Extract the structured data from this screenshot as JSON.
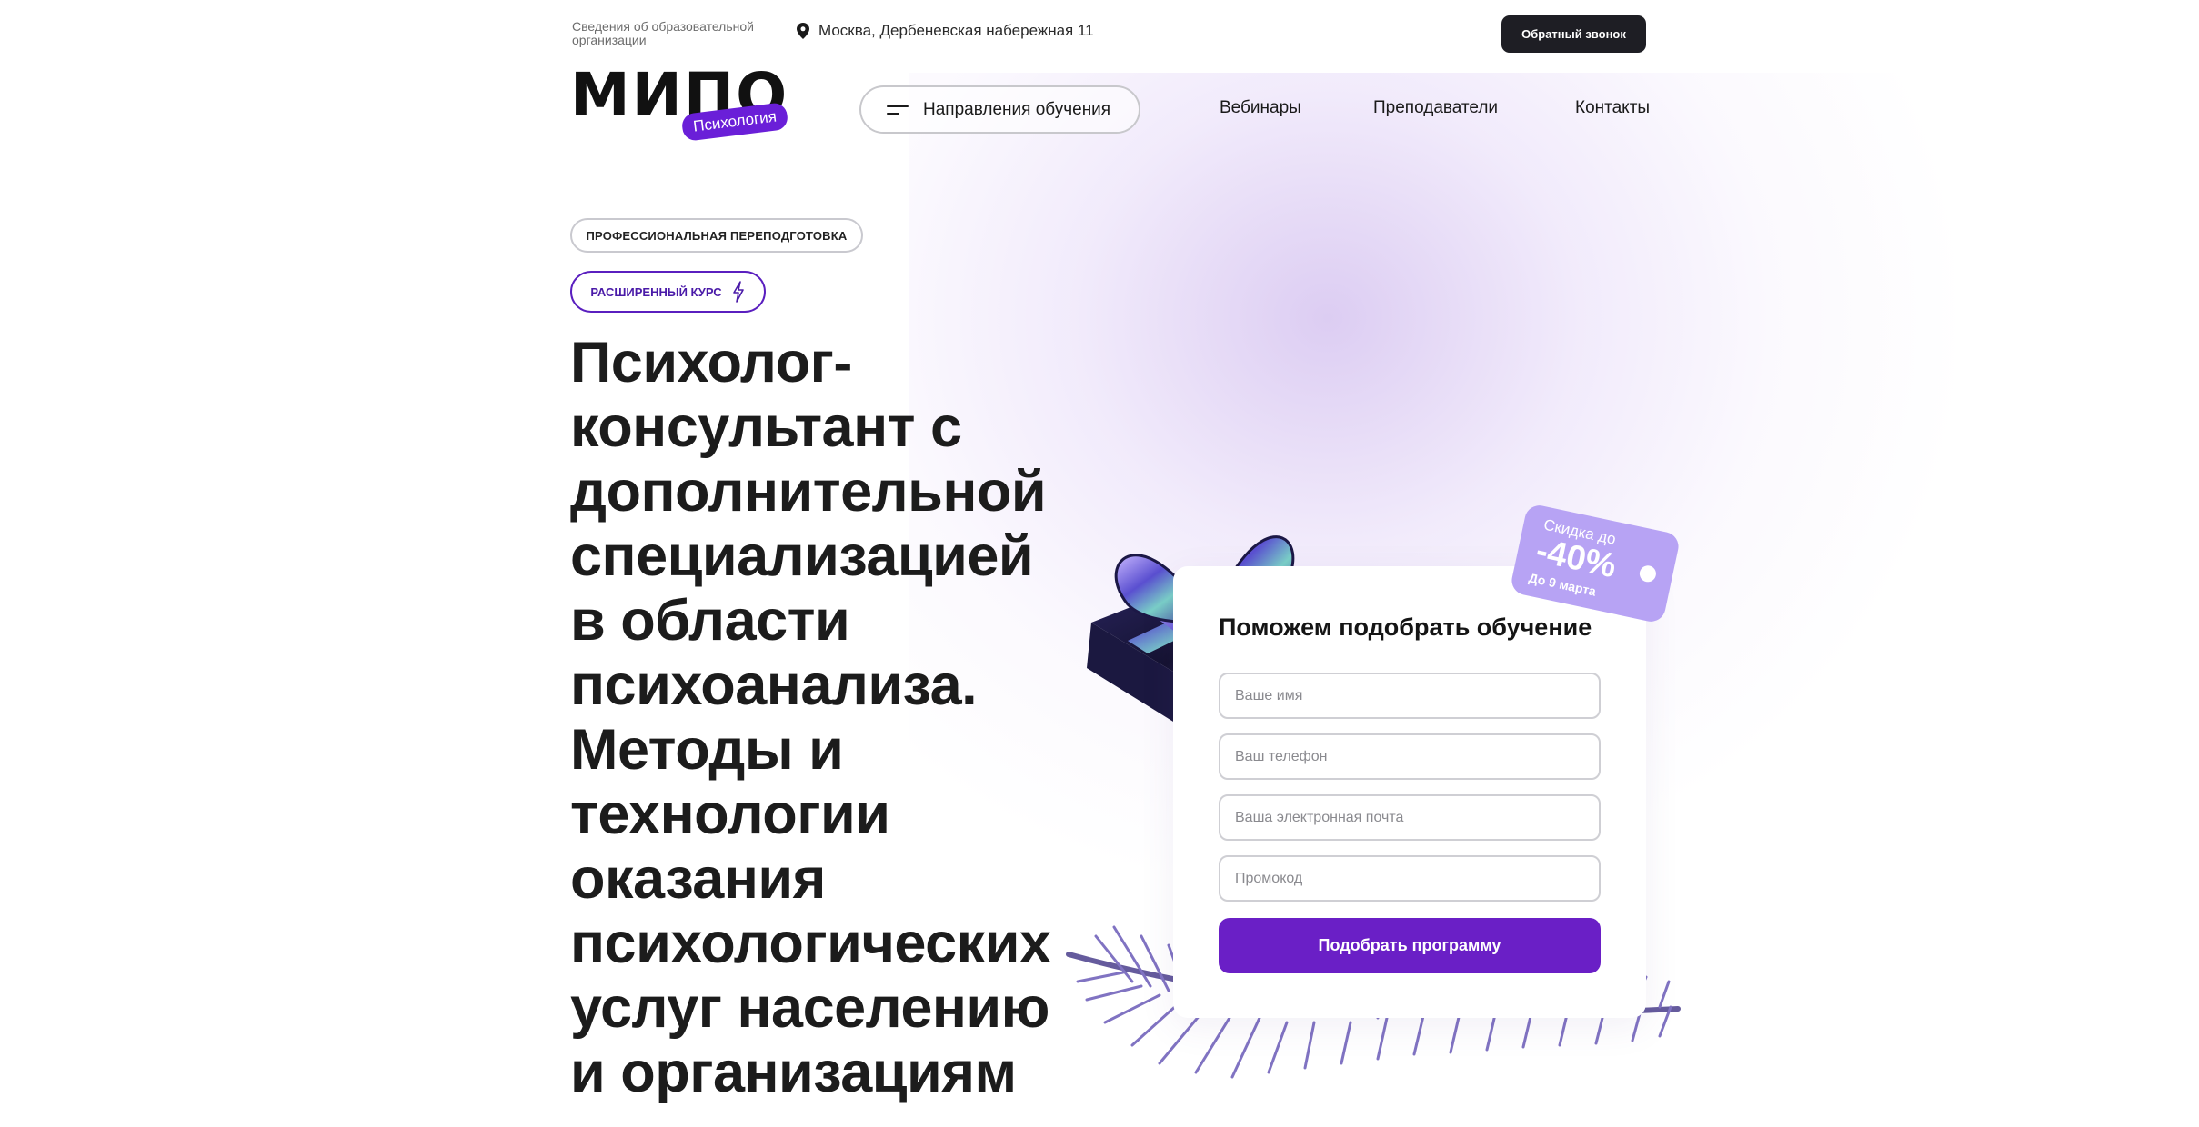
{
  "topbar": {
    "org_link": "Сведения об образовательной организации",
    "address": "Москва, Дербеневская набережная 11",
    "callback_label": "Обратный звонок"
  },
  "logo": {
    "word": "МИПО",
    "badge": "Психология"
  },
  "nav": {
    "directions_label": "Направления обучения",
    "links": [
      "Вебинары",
      "Преподаватели",
      "Контакты"
    ]
  },
  "hero": {
    "tag_retraining": "ПРОФЕССИОНАЛЬНАЯ ПЕРЕПОДГОТОВКА",
    "tag_extended": "РАСШИРЕННЫЙ КУРС",
    "headline_lines": [
      "Психолог-",
      "консультант с",
      "дополнительной",
      "специализацией",
      "в области",
      "психоанализа.",
      "Методы и",
      "технологии",
      "оказания",
      "психологических",
      "услуг населению",
      "и организациям"
    ]
  },
  "discount": {
    "top": "Скидка до",
    "value": "-40%",
    "until": "До 9 марта"
  },
  "form": {
    "title": "Поможем подобрать обучение",
    "name_placeholder": "Ваше имя",
    "phone_placeholder": "Ваш телефон",
    "email_placeholder": "Ваша электронная почта",
    "promo_placeholder": "Промокод",
    "submit_label": "Подобрать программу"
  },
  "colors": {
    "accent": "#6a1fc6",
    "dark_button": "#1e1e24",
    "discount_tag": "#b7a3f4"
  }
}
